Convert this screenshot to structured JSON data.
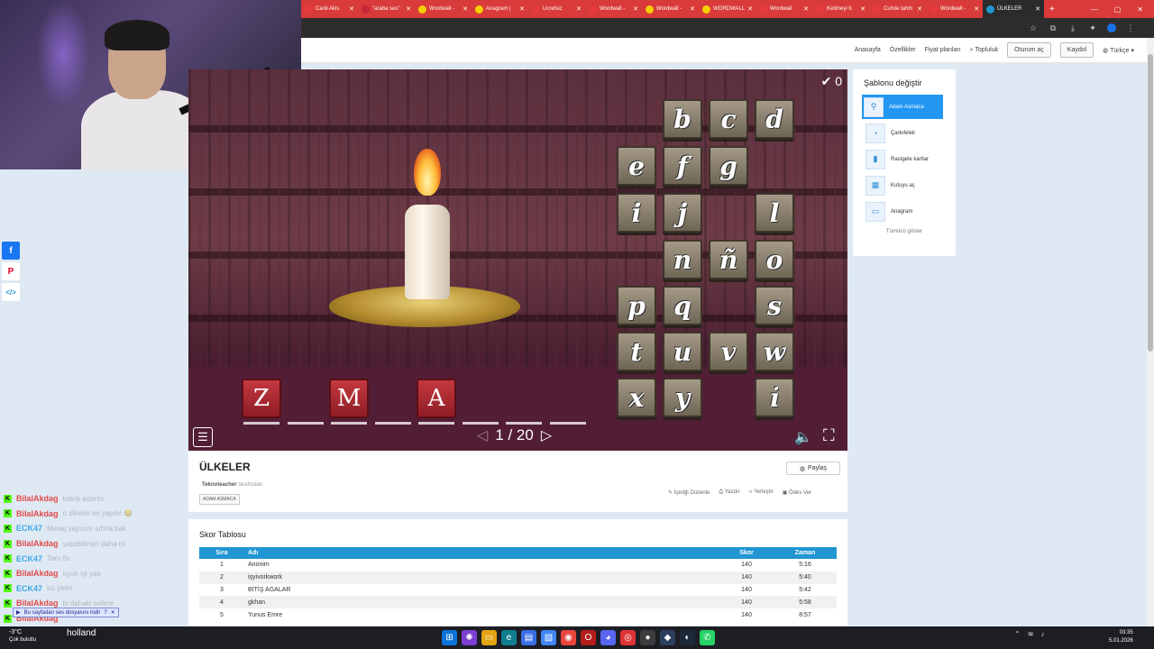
{
  "browser": {
    "tabs": [
      "Canli Akis",
      "\"araba ses\"",
      "Wordwall -",
      "Anagram |",
      "Ucretsiz",
      "Wordwall -",
      "Wordwall -",
      "WORDWALL",
      "Wordwall",
      "Kelimeyi b",
      "Cumle tahm",
      "Wordwall -"
    ],
    "active_tab": "ÜLKELER",
    "new_tab": "+"
  },
  "site_header": {
    "home": "Anasayfa",
    "features": "Özellikler",
    "pricing": "Fiyat planları",
    "community": "Topluluk",
    "login": "Oturum aç",
    "register": "Kaydol",
    "language": "Türkçe"
  },
  "game": {
    "score": "0",
    "letters": [
      "b",
      "c",
      "d",
      "e",
      "f",
      "g",
      "i",
      "j",
      "l",
      "n",
      "ñ",
      "o",
      "p",
      "q",
      "s",
      "t",
      "u",
      "v",
      "w",
      "x",
      "y",
      "i̇"
    ],
    "answer_letters": [
      "Z",
      "M",
      "A"
    ],
    "page": "1 / 20"
  },
  "templates": {
    "title": "Şablonu değiştir",
    "items": [
      {
        "label": "Adam Asmaca",
        "icon": "hangman-icon"
      },
      {
        "label": "Çarkıfelek",
        "icon": "wheel-icon"
      },
      {
        "label": "Rastgele kartlar",
        "icon": "cards-icon"
      },
      {
        "label": "Kutuyu aç",
        "icon": "box-icon"
      },
      {
        "label": "Anagram",
        "icon": "anagram-icon"
      }
    ],
    "show_all": "Tümünü göster"
  },
  "activity": {
    "title": "ÜLKELER",
    "author": "Teknoteacher",
    "author_suffix": "tarafından",
    "tag": "ADAM ASMACA",
    "share": "Paylaş",
    "actions": [
      "İçeriği Düzenle",
      "Yazdır",
      "Yerleştir",
      "Ödev Ver"
    ]
  },
  "scoreboard": {
    "title": "Skor Tablosu",
    "columns": [
      "Sıra",
      "Adı",
      "Skor",
      "Zaman"
    ],
    "rows": [
      [
        "1",
        "Anonim",
        "140",
        "5:16"
      ],
      [
        "2",
        "işyivorkwork",
        "140",
        "5:40"
      ],
      [
        "3",
        "BİTİŞ AGALAR",
        "140",
        "5:42"
      ],
      [
        "4",
        "gkhan",
        "140",
        "5:58"
      ],
      [
        "5",
        "Yunus Emre",
        "140",
        "8:57"
      ]
    ]
  },
  "chat": {
    "messages": [
      {
        "user": "BilalAkdag",
        "text": "tebrik ederim",
        "color": "#e24a4a"
      },
      {
        "user": "BilalAkdag",
        "text": "o ülkede ne yapılır 😂",
        "color": "#e24a4a"
      },
      {
        "user": "ECK47",
        "text": "Mesaj sayısını sıfırla bak",
        "color": "#3da8e8"
      },
      {
        "user": "BilalAkdag",
        "text": "yapabilirsin daha iyi",
        "color": "#e24a4a"
      },
      {
        "user": "ECK47",
        "text": "Tam 8x",
        "color": "#3da8e8"
      },
      {
        "user": "BilalAkdag",
        "text": "oyun iyi yaa",
        "color": "#e24a4a"
      },
      {
        "user": "ECK47",
        "text": "bu yeter",
        "color": "#3da8e8"
      },
      {
        "user": "BilalAkdag",
        "text": "bi dahaki sefere",
        "color": "#e24a4a"
      },
      {
        "user": "BilalAkdag",
        "text": "",
        "color": "#e24a4a"
      }
    ],
    "audio_notice": "Bu sayfadan ses dosyasını indir",
    "overlay_word": "holland"
  },
  "taskbar": {
    "weather_temp": "-3°C",
    "weather_desc": "Çok bulutlu",
    "time": "03:35",
    "date": "5.01.2026"
  },
  "colors": {
    "header_blue": "#2196d3",
    "template_active": "#2196f3",
    "tab_bar": "#d93a3a"
  }
}
